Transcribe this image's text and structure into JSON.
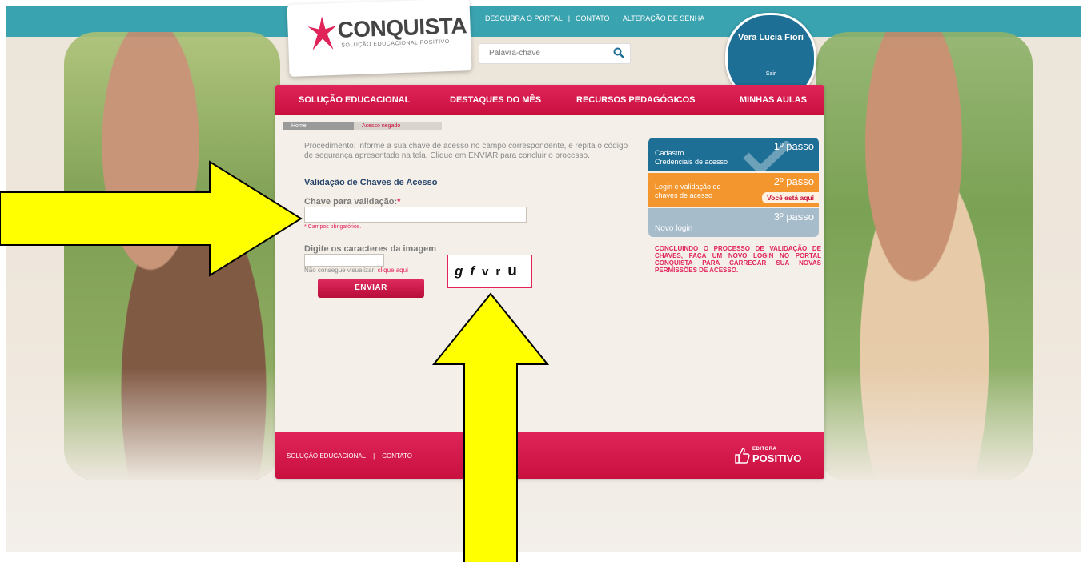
{
  "brand": {
    "logo_text": "CONQUISTA",
    "logo_subtitle": "SOLUÇÃO EDUCACIONAL POSITIVO",
    "accent": "#c8103e",
    "teal": "#3aa3b0"
  },
  "top_links": [
    "DESCUBRA O PORTAL",
    "CONTATO",
    "ALTERAÇÃO DE SENHA"
  ],
  "search": {
    "placeholder": "Palavra-chave",
    "icon": "search-icon"
  },
  "user": {
    "name": "Vera Lucia Fiori",
    "logout": "Sair"
  },
  "nav": [
    "SOLUÇÃO EDUCACIONAL",
    "DESTAQUES DO MÊS",
    "RECURSOS PEDAGÓGICOS",
    "MINHAS AULAS"
  ],
  "breadcrumb": {
    "home": "Home",
    "current": "Acesso negado"
  },
  "form": {
    "intro": "Procedimento: informe a sua chave de acesso no campo correspondente, e repita o código de segurança apresentado na tela. Clique em ENVIAR para concluir o processo.",
    "title": "Validação de Chaves de Acesso",
    "key_label": "Chave para validação:",
    "required_marker": "*",
    "required_note": "* Campos obrigatórios.",
    "captcha_label": "Digite os caracteres da imagem",
    "cant_see_text": "Não consegue visualizar: ",
    "cant_see_link": "clique aqui",
    "captcha_chars": [
      "g",
      "f",
      "v",
      "r",
      "u"
    ],
    "send_label": "ENVIAR"
  },
  "steps": [
    {
      "num": "1",
      "suffix": "º passo",
      "text_line1": "Cadastro",
      "text_line2": "Credenciais de acesso",
      "color": "#1e6f96"
    },
    {
      "num": "2",
      "suffix": "º passo",
      "text_line1": "Login e validação de",
      "text_line2": "chaves de acesso",
      "badge": "Você está aqui",
      "color": "#f4962e"
    },
    {
      "num": "3",
      "suffix": "º passo",
      "text_line1": "Novo login",
      "color": "#a7bccb"
    }
  ],
  "notice": "CONCLUINDO O PROCESSO DE VALIDAÇÃO DE CHAVES, FAÇA UM NOVO LOGIN NO PORTAL CONQUISTA PARA CARREGAR SUA NOVAS PERMISSÕES DE ACESSO.",
  "footer": {
    "links": [
      "SOLUÇÃO EDUCACIONAL",
      "CONTATO"
    ],
    "logo_small": "EDITORA",
    "logo_big": "POSITIVO"
  },
  "annotations": {
    "arrow_color": "#ffff00"
  }
}
